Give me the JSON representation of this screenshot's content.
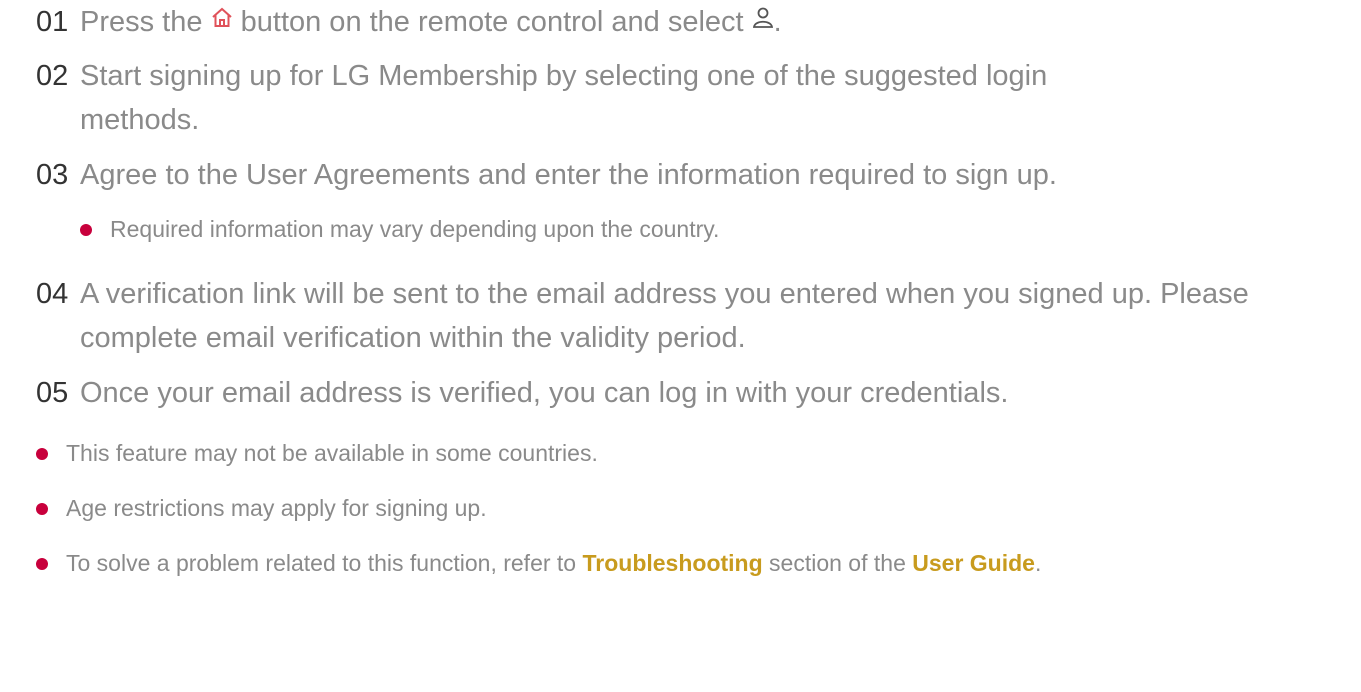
{
  "colors": {
    "text": "#8a8a8a",
    "number": "#333333",
    "bullet": "#c8003c",
    "link": "#c89b1e",
    "home_icon": "#e0525a"
  },
  "steps": [
    {
      "num": "01",
      "text_before": "Press the",
      "icon1": "home-icon",
      "text_mid": "button on the remote control and select",
      "icon2": "user-icon",
      "text_after": "."
    },
    {
      "num": "02",
      "text": "Start signing up for LG Membership by selecting one of the suggested login methods."
    },
    {
      "num": "03",
      "text": "Agree to the User Agreements and enter the information required to sign up.",
      "sub_note": "Required information may vary depending upon the country."
    },
    {
      "num": "04",
      "text": "A verification link will be sent to the email address you entered when you signed up. Please complete email verification within the validity period."
    },
    {
      "num": "05",
      "text": "Once your email address is verified, you can log in with your credentials."
    }
  ],
  "notes": [
    {
      "text": "This feature may not be available in some countries."
    },
    {
      "text": "Age restrictions may apply for signing up."
    },
    {
      "text_before": "To solve a problem related to this function, refer to",
      "link1": "Troubleshooting",
      "text_mid": "section of the",
      "link2": "User Guide",
      "text_after": "."
    }
  ]
}
